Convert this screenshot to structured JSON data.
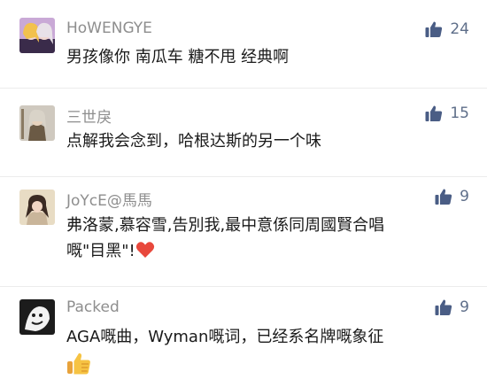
{
  "comments": [
    {
      "username": "HoWENGYE",
      "text": "男孩像你 南瓜车 糖不甩 经典啊",
      "likes": "24",
      "avatar_icon": "two-girls-avatar-icon"
    },
    {
      "username": "三世戾",
      "text": "点解我会念到，哈根达斯的另一个味",
      "likes": "15",
      "avatar_icon": "warrior-avatar-icon"
    },
    {
      "username": "JoYcE@馬馬",
      "text_line1": "弗洛蒙,慕容雪,告別我,最中意係同周國賢合唱",
      "text_line2": "嘅\"目黑\"!",
      "likes": "9",
      "avatar_icon": "woman-avatar-icon",
      "emoji": "red-heart-icon"
    },
    {
      "username": "Packed",
      "text": "AGA嘅曲，Wyman嘅词，已经系名牌嘅象征",
      "likes": "9",
      "avatar_icon": "bw-portrait-avatar-icon",
      "emoji": "thumbs-up-emoji-icon"
    }
  ],
  "colors": {
    "username": "#8e8e8e",
    "like_icon": "#4a5d85",
    "like_count": "#5f6f8a",
    "text": "#1a1a1a",
    "heart": "#e8483c",
    "divider": "#ececec"
  }
}
